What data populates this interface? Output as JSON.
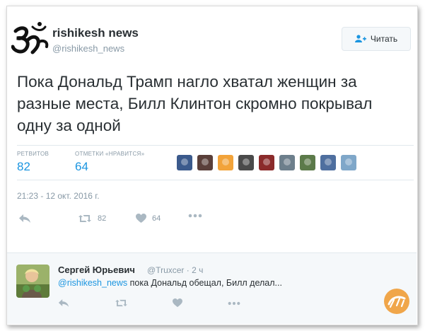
{
  "account": {
    "name": "rishikesh news",
    "handle": "@rishikesh_news",
    "logo_icon": "om-symbol-icon"
  },
  "follow_button": {
    "label": "Читать",
    "icon": "add-user-icon"
  },
  "tweet": {
    "text": "Пока Дональд Трамп нагло хватал женщин за разные места, Билл Клинтон скромно покрывал одну за одной",
    "timestamp": "21:23 - 12 окт. 2016 г."
  },
  "stats": {
    "retweets_label": "РЕТВИТОВ",
    "retweets_count": "82",
    "likes_label": "ОТМЕТКИ «НРАВИТСЯ»",
    "likes_count": "64",
    "liker_avatars": [
      "#3b5a8c",
      "#5a3f3a",
      "#f2a33a",
      "#4a4a4a",
      "#8b2b2b",
      "#6d7f8c",
      "#5c7a4a",
      "#4f6f9f",
      "#7fa7c9"
    ]
  },
  "actions": {
    "reply_icon": "reply-icon",
    "retweet_icon": "retweet-icon",
    "retweet_count": "82",
    "like_icon": "heart-icon",
    "like_count": "64",
    "more_icon": "more-icon"
  },
  "reply": {
    "name": "Сергей Юрьевич",
    "handle": "@Truxcer",
    "time": "· 2 ч",
    "mention": "@rishikesh_news",
    "text": " пока Дональд обещал, Билл делал..."
  },
  "colors": {
    "accent": "#1b95e0",
    "muted": "#8899a6",
    "text": "#292f33"
  }
}
